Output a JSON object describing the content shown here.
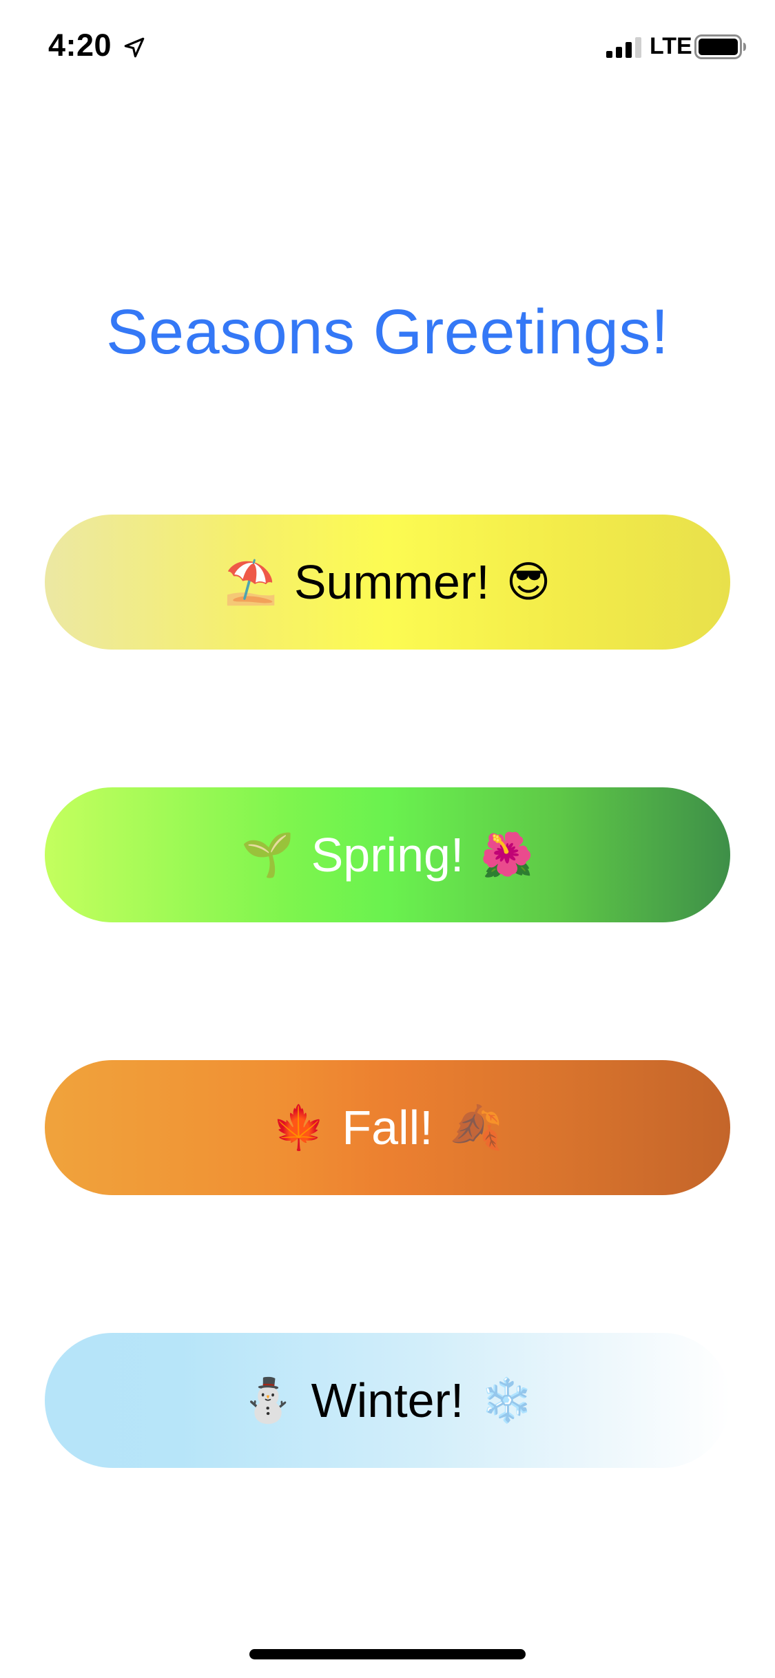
{
  "status_bar": {
    "time": "4:20",
    "network": "LTE",
    "icons": [
      "location-arrow-icon",
      "cellular-signal-icon",
      "battery-icon"
    ]
  },
  "title": "Seasons Greetings!",
  "colors": {
    "title": "#3478f6",
    "summer": "#fcfb52",
    "spring": "#6af24f",
    "fall": "#ec8030",
    "winter": "#b6e4f9"
  },
  "buttons": [
    {
      "id": "summer",
      "label": "Summer!",
      "emoji_left": "⛱️",
      "emoji_right": "😎"
    },
    {
      "id": "spring",
      "label": "Spring!",
      "emoji_left": "🌱",
      "emoji_right": "🌺"
    },
    {
      "id": "fall",
      "label": "Fall!",
      "emoji_left": "🍁",
      "emoji_right": "🍂"
    },
    {
      "id": "winter",
      "label": "Winter!",
      "emoji_left": "⛄",
      "emoji_right": "❄️"
    }
  ]
}
